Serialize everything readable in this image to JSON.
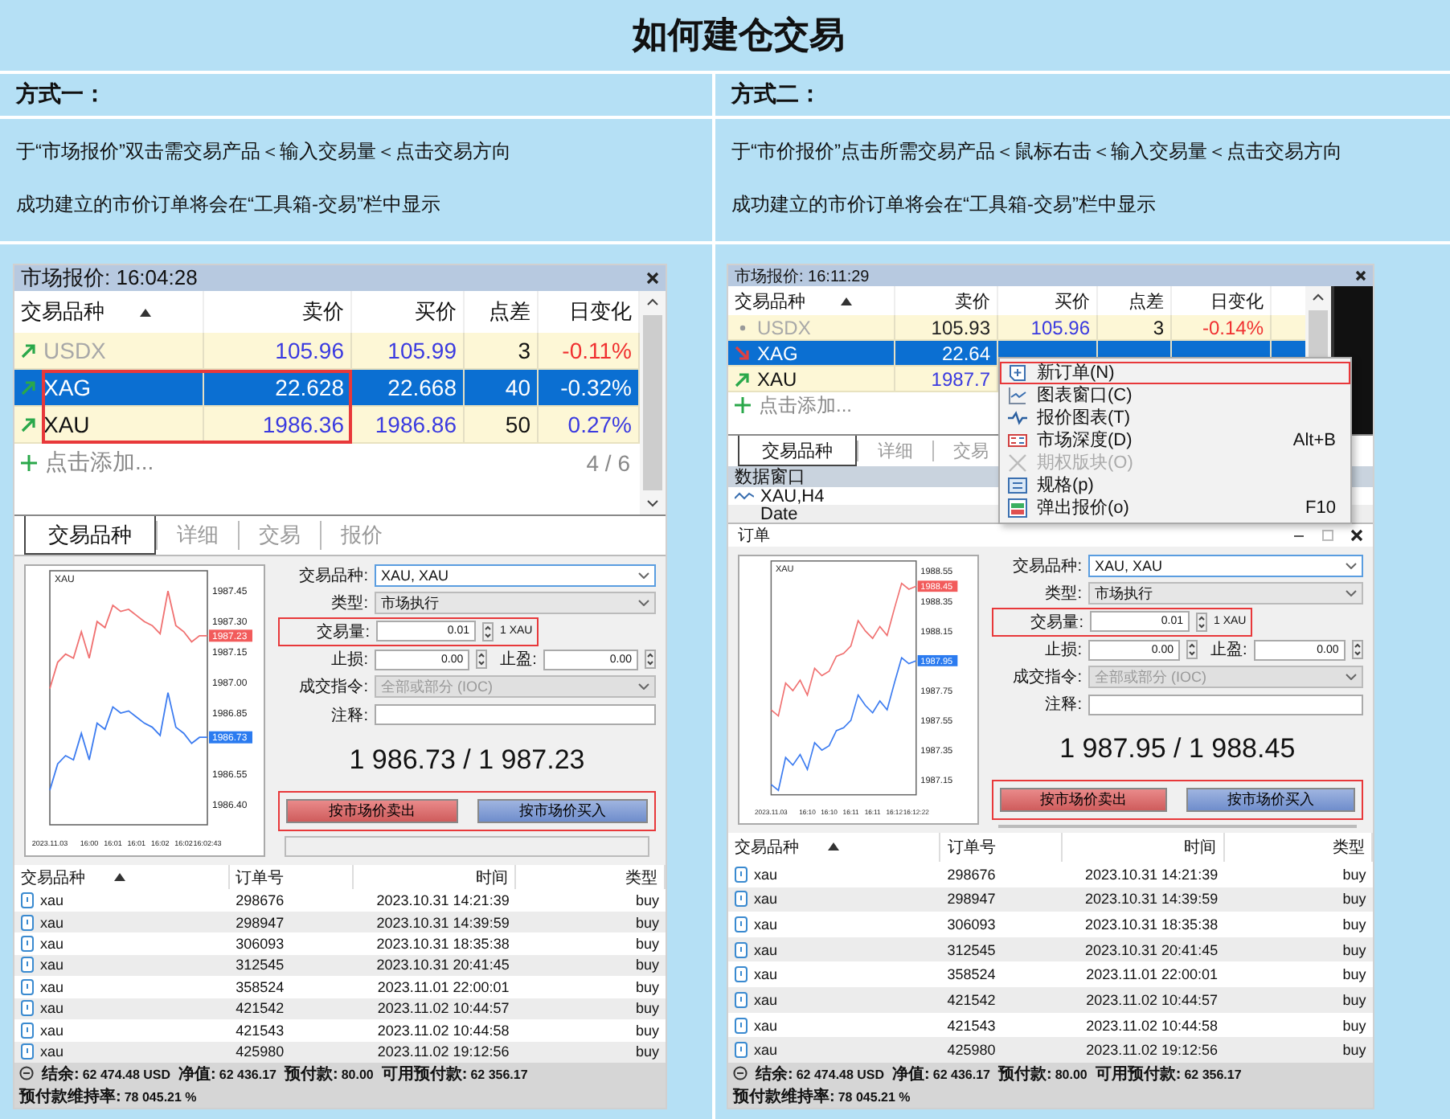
{
  "title": "如何建仓交易",
  "methods": [
    {
      "heading": "方式一：",
      "lines": [
        "于“市场报价”双击需交易产品＜输入交易量＜点击交易方向",
        "成功建立的市价订单将会在“工具箱-交易”栏中显示"
      ],
      "market_watch": {
        "title": "市场报价: 16:04:28",
        "columns": [
          "交易品种",
          "卖价",
          "买价",
          "点差",
          "日变化"
        ],
        "rows": [
          {
            "kind": "up",
            "symbol": "USDX",
            "dimmed": true,
            "selected": false,
            "highlighted": false,
            "bid": {
              "text": "105.96",
              "color": "#3a3ae0"
            },
            "ask": {
              "text": "105.99",
              "color": "#3a3ae0"
            },
            "spread": "3",
            "change": {
              "text": "-0.11%",
              "color": "#f03030"
            }
          },
          {
            "kind": "up",
            "symbol": "XAG",
            "dimmed": false,
            "selected": true,
            "highlighted": true,
            "bid": {
              "text": "22.628"
            },
            "ask": {
              "text": "22.668"
            },
            "spread": "40",
            "change": {
              "text": "-0.32%"
            }
          },
          {
            "kind": "up",
            "symbol": "XAU",
            "dimmed": false,
            "selected": false,
            "highlighted": true,
            "bid": {
              "text": "1986.36",
              "color": "#3a3ae0"
            },
            "ask": {
              "text": "1986.86",
              "color": "#3a3ae0"
            },
            "spread": "50",
            "change": {
              "text": "0.27%",
              "color": "#3a3ae0"
            }
          }
        ],
        "add_label": "点击添加...",
        "count": "4 / 6",
        "tabs": [
          {
            "label": "交易品种",
            "selected": true
          },
          {
            "label": "详细",
            "selected": false
          },
          {
            "label": "交易",
            "selected": false
          },
          {
            "label": "报价",
            "selected": false
          }
        ]
      },
      "order_dialog": {
        "chart_data": {
          "type": "line",
          "title": "XAU",
          "categories": [
            "2023.11.03",
            null,
            null,
            null,
            null,
            "16:00",
            null,
            null,
            "16:01",
            null,
            null,
            "16:01",
            null,
            null,
            "16:02",
            null,
            null,
            "16:02",
            null,
            null,
            "16:02:43"
          ],
          "series": [
            {
              "color": "#f07070",
              "values": [
                1986.97,
                1987.1,
                1987.14,
                1987.12,
                1987.25,
                1987.12,
                1987.3,
                1987.27,
                1987.38,
                1987.35,
                1987.36,
                1987.33,
                1987.3,
                1987.28,
                1987.24,
                1987.45,
                1987.28,
                1987.25,
                1987.2,
                1987.23,
                1987.23
              ]
            },
            {
              "color": "#3b7bf0",
              "values": [
                1986.47,
                1986.6,
                1986.64,
                1986.62,
                1986.75,
                1986.62,
                1986.8,
                1986.77,
                1986.88,
                1986.85,
                1986.86,
                1986.83,
                1986.8,
                1986.78,
                1986.74,
                1986.95,
                1986.78,
                1986.75,
                1986.7,
                1986.73,
                1986.73
              ]
            }
          ],
          "ylim": [
            1986.3,
            1987.55
          ],
          "yticks": [
            {
              "value": 1987.45,
              "label": "1987.45"
            },
            {
              "value": 1987.3,
              "label": "1987.30"
            },
            {
              "value": 1987.15,
              "label": "1987.15"
            },
            {
              "value": 1987.0,
              "label": "1987.00"
            },
            {
              "value": 1986.85,
              "label": "1986.85"
            },
            {
              "value": 1986.55,
              "label": "1986.55"
            },
            {
              "value": 1986.4,
              "label": "1986.40"
            }
          ],
          "annotations": [
            "1987.23",
            "1986.73"
          ]
        },
        "rows": [
          {
            "kind": "select",
            "label": "交易品种:",
            "value": "XAU, XAU",
            "focused": true,
            "disabled": false
          },
          {
            "kind": "select",
            "label": "类型:",
            "value": "市场执行",
            "focused": false,
            "disabled": false
          },
          {
            "kind": "spin",
            "label": "交易量:",
            "value": "0.01",
            "unit": "1 XAU",
            "highlighted": true
          },
          {
            "kind": "spin_pair",
            "label": "止损:",
            "value": "0.00",
            "label_2": "止盈:",
            "value_2": "0.00"
          },
          {
            "kind": "select",
            "label": "成交指令:",
            "value": "全部或部分 (IOC)",
            "focused": false,
            "disabled": true
          },
          {
            "kind": "text",
            "label": "注释:"
          }
        ],
        "price": "1 986.73 / 1 987.23",
        "buttons": [
          {
            "kind": "sell",
            "label": "按市场价卖出"
          },
          {
            "kind": "buy",
            "label": "按市场价买入"
          }
        ],
        "buttons_highlighted": true
      },
      "orders": {
        "columns": [
          "交易品种",
          "订单号",
          "时间",
          "类型"
        ],
        "rows": [
          {
            "symbol": "xau",
            "order": "298676",
            "time": "2023.10.31 14:21:39",
            "type": "buy"
          },
          {
            "symbol": "xau",
            "order": "298947",
            "time": "2023.10.31 14:39:59",
            "type": "buy"
          },
          {
            "symbol": "xau",
            "order": "306093",
            "time": "2023.10.31 18:35:38",
            "type": "buy"
          },
          {
            "symbol": "xau",
            "order": "312545",
            "time": "2023.10.31 20:41:45",
            "type": "buy"
          },
          {
            "symbol": "xau",
            "order": "358524",
            "time": "2023.11.01 22:00:01",
            "type": "buy"
          },
          {
            "symbol": "xau",
            "order": "421542",
            "time": "2023.11.02 10:44:57",
            "type": "buy"
          },
          {
            "symbol": "xau",
            "order": "421543",
            "time": "2023.11.02 10:44:58",
            "type": "buy"
          },
          {
            "symbol": "xau",
            "order": "425980",
            "time": "2023.11.02 19:12:56",
            "type": "buy"
          }
        ]
      },
      "status_bar": [
        {
          "label": "结余:",
          "value": "62 474.48 USD"
        },
        {
          "label": "净值:",
          "value": "62 436.17"
        },
        {
          "label": "预付款:",
          "value": "80.00"
        },
        {
          "label": "可用预付款:",
          "value": "62 356.17"
        },
        {
          "label": "预付款维持率:",
          "value": "78 045.21 %"
        }
      ]
    },
    {
      "heading": "方式二：",
      "lines": [
        "于“市价报价”点击所需交易产品＜鼠标右击＜输入交易量＜点击交易方向",
        "成功建立的市价订单将会在“工具箱-交易”栏中显示"
      ],
      "market_watch": {
        "title": "市场报价: 16:11:29",
        "columns": [
          "交易品种",
          "卖价",
          "买价",
          "点差",
          "日变化"
        ],
        "rows": [
          {
            "kind": "flat",
            "symbol": "USDX",
            "dimmed": true,
            "selected": false,
            "highlighted": false,
            "bid": {
              "text": "105.93",
              "color": "#222222"
            },
            "ask": {
              "text": "105.96",
              "color": "#3a3ae0"
            },
            "spread": "3",
            "change": {
              "text": "-0.14%",
              "color": "#f03030"
            }
          },
          {
            "kind": "down",
            "symbol": "XAG",
            "dimmed": false,
            "selected": true,
            "highlighted": false,
            "bid": {
              "text": "22.64"
            }
          },
          {
            "kind": "up",
            "symbol": "XAU",
            "dimmed": false,
            "selected": false,
            "highlighted": false,
            "bid": {
              "text": "1987.7",
              "color": "#3a3ae0"
            }
          }
        ],
        "add_label": "点击添加...",
        "tabs": [
          {
            "label": "交易品种",
            "selected": true
          },
          {
            "label": "详细",
            "selected": false
          },
          {
            "label": "交易",
            "selected": false
          }
        ],
        "context_menu": [
          {
            "kind": "new-order",
            "label": "新订单(N)",
            "highlighted": true,
            "disabled": false
          },
          {
            "kind": "chart",
            "label": "图表窗口(C)",
            "highlighted": false,
            "disabled": false
          },
          {
            "kind": "tick",
            "label": "报价图表(T)",
            "highlighted": false,
            "disabled": false
          },
          {
            "kind": "depth",
            "label": "市场深度(D)",
            "shortcut": "Alt+B",
            "highlighted": false,
            "disabled": false
          },
          {
            "kind": "options",
            "label": "期权版块(O)",
            "highlighted": false,
            "disabled": true
          },
          {
            "kind": "spec",
            "label": "规格(p)",
            "highlighted": false,
            "disabled": false
          },
          {
            "kind": "popup",
            "label": "弹出报价(o)",
            "shortcut": "F10",
            "highlighted": false,
            "disabled": false
          }
        ]
      },
      "data_window": {
        "title": "数据窗口",
        "rows": [
          {
            "kind": "chart",
            "text": "XAU,H4"
          },
          {
            "kind": "field",
            "text": "Date"
          }
        ]
      },
      "order_dialog": {
        "title": "订单",
        "chart_data": {
          "type": "line",
          "title": "XAU",
          "categories": [
            "2023.11.03",
            null,
            null,
            null,
            null,
            "16:10",
            null,
            null,
            "16:10",
            null,
            null,
            "16:11",
            null,
            null,
            "16:11",
            null,
            null,
            "16:12",
            null,
            null,
            "16:12:22"
          ],
          "series": [
            {
              "color": "#f07070",
              "values": [
                1987.62,
                1987.58,
                1987.8,
                1987.75,
                1987.82,
                1987.72,
                1987.9,
                1987.85,
                1987.88,
                1987.98,
                1988.0,
                1988.05,
                1988.22,
                1988.15,
                1988.1,
                1988.18,
                1988.12,
                1988.3,
                1988.47,
                1988.43,
                1988.45
              ]
            },
            {
              "color": "#3b7bf0",
              "values": [
                1987.12,
                1987.08,
                1987.3,
                1987.25,
                1987.32,
                1987.22,
                1987.4,
                1987.35,
                1987.38,
                1987.48,
                1987.5,
                1987.55,
                1987.72,
                1987.65,
                1987.6,
                1987.68,
                1987.62,
                1987.8,
                1987.97,
                1987.93,
                1987.95
              ]
            }
          ],
          "ylim": [
            1987.05,
            1988.62
          ],
          "yticks": [
            {
              "value": 1988.55,
              "label": "1988.55"
            },
            {
              "value": 1988.35,
              "label": "1988.35"
            },
            {
              "value": 1988.15,
              "label": "1988.15"
            },
            {
              "value": 1987.75,
              "label": "1987.75"
            },
            {
              "value": 1987.55,
              "label": "1987.55"
            },
            {
              "value": 1987.35,
              "label": "1987.35"
            },
            {
              "value": 1987.15,
              "label": "1987.15"
            }
          ],
          "annotations": [
            "1988.45",
            "1987.95"
          ]
        },
        "rows": [
          {
            "kind": "select",
            "label": "交易品种:",
            "value": "XAU, XAU",
            "focused": true,
            "disabled": false
          },
          {
            "kind": "select",
            "label": "类型:",
            "value": "市场执行",
            "focused": false,
            "disabled": false
          },
          {
            "kind": "spin",
            "label": "交易量:",
            "value": "0.01",
            "unit": "1 XAU",
            "highlighted": true
          },
          {
            "kind": "spin_pair",
            "label": "止损:",
            "value": "0.00",
            "label_2": "止盈:",
            "value_2": "0.00"
          },
          {
            "kind": "select",
            "label": "成交指令:",
            "value": "全部或部分 (IOC)",
            "focused": false,
            "disabled": true
          },
          {
            "kind": "text",
            "label": "注释:"
          }
        ],
        "price": "1 987.95 / 1 988.45",
        "buttons": [
          {
            "kind": "sell",
            "label": "按市场价卖出"
          },
          {
            "kind": "buy",
            "label": "按市场价买入"
          }
        ],
        "buttons_highlighted": true
      },
      "orders": {
        "columns": [
          "交易品种",
          "订单号",
          "时间",
          "类型"
        ],
        "rows": [
          {
            "symbol": "xau",
            "order": "298676",
            "time": "2023.10.31 14:21:39",
            "type": "buy"
          },
          {
            "symbol": "xau",
            "order": "298947",
            "time": "2023.10.31 14:39:59",
            "type": "buy"
          },
          {
            "symbol": "xau",
            "order": "306093",
            "time": "2023.10.31 18:35:38",
            "type": "buy"
          },
          {
            "symbol": "xau",
            "order": "312545",
            "time": "2023.10.31 20:41:45",
            "type": "buy"
          },
          {
            "symbol": "xau",
            "order": "358524",
            "time": "2023.11.01 22:00:01",
            "type": "buy"
          },
          {
            "symbol": "xau",
            "order": "421542",
            "time": "2023.11.02 10:44:57",
            "type": "buy"
          },
          {
            "symbol": "xau",
            "order": "421543",
            "time": "2023.11.02 10:44:58",
            "type": "buy"
          },
          {
            "symbol": "xau",
            "order": "425980",
            "time": "2023.11.02 19:12:56",
            "type": "buy"
          }
        ]
      },
      "status_bar": [
        {
          "label": "结余:",
          "value": "62 474.48 USD"
        },
        {
          "label": "净值:",
          "value": "62 436.17"
        },
        {
          "label": "预付款:",
          "value": "80.00"
        },
        {
          "label": "可用预付款:",
          "value": "62 356.17"
        },
        {
          "label": "预付款维持率:",
          "value": "78 045.21 %"
        }
      ]
    }
  ]
}
